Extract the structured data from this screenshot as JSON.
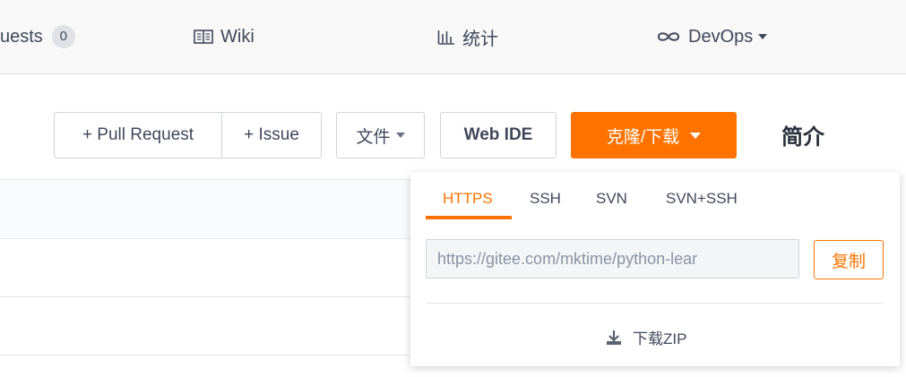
{
  "tabs": {
    "pull_requests_label": "uests",
    "pull_requests_count": "0",
    "wiki_label": "Wiki",
    "stats_label": "统计",
    "devops_label": "DevOps"
  },
  "toolbar": {
    "pull_request_label": "+ Pull Request",
    "issue_label": "+ Issue",
    "file_label": "文件",
    "web_ide_label": "Web IDE",
    "clone_label": "克隆/下载"
  },
  "intro_title": "简介",
  "clone_popup": {
    "tabs": [
      "HTTPS",
      "SSH",
      "SVN",
      "SVN+SSH"
    ],
    "active_tab": "HTTPS",
    "url_value": "https://gitee.com/mktime/python-lear",
    "copy_label": "复制",
    "download_zip_label": "下载ZIP"
  },
  "colors": {
    "accent": "#fe7300",
    "text": "#40485b",
    "border": "#d0d3d9"
  }
}
